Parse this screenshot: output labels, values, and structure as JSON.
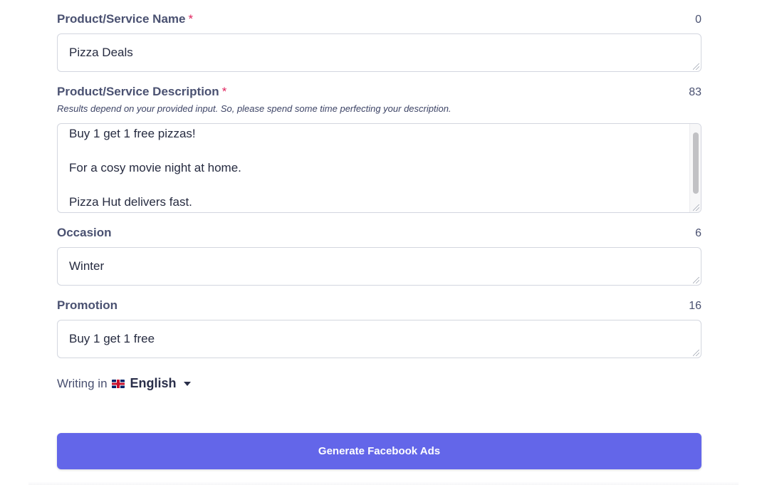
{
  "fields": [
    {
      "label": "Product/Service Name",
      "required": "*",
      "count": "0",
      "value": "Pizza Deals"
    },
    {
      "label": "Product/Service Description",
      "required": "*",
      "count": "83",
      "hint": "Results depend on your provided input. So, please spend some time perfecting your description.",
      "lines": [
        "Buy 1 get 1 free pizzas!",
        "For a cosy movie night at home.",
        "Pizza Hut delivers fast."
      ]
    },
    {
      "label": "Occasion",
      "count": "6",
      "value": "Winter"
    },
    {
      "label": "Promotion",
      "count": "16",
      "value": "Buy 1 get 1 free"
    }
  ],
  "language": {
    "prefix": "Writing in",
    "flag_icon": "uk-flag-icon",
    "name": "English"
  },
  "generate_button": {
    "label": "Generate Facebook Ads"
  },
  "colors": {
    "accent": "#6366e9",
    "required": "#e0245e"
  }
}
